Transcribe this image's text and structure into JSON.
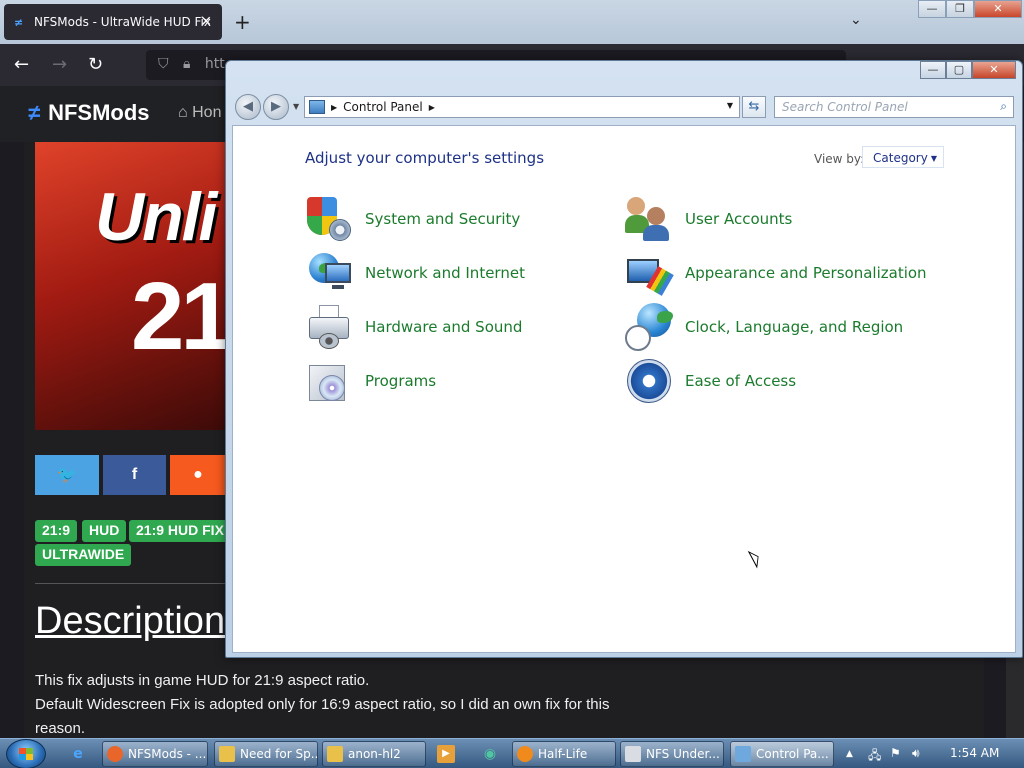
{
  "browser": {
    "tab_title": "NFSMods - UltraWide HUD Fix",
    "tab_close": "✕",
    "new_tab": "+",
    "tab_list": "⌄",
    "url_text": "htt",
    "win_min": "—",
    "win_max": "❐",
    "win_close": "✕",
    "nav_back": "←",
    "nav_forward": "→",
    "nav_reload": "↻"
  },
  "site": {
    "logo_text": "NFSMods",
    "home_text": "Hon",
    "hero_title": "Unli",
    "hero_ratio": "21:",
    "share": [
      {
        "label": "🐦",
        "color": "#4ca3e4"
      },
      {
        "label": "f",
        "color": "#3b5a9a"
      },
      {
        "label": "●",
        "color": "#f65a1e"
      }
    ],
    "tags": [
      "21:9",
      "HUD",
      "21:9 HUD FIX",
      "ULTRAWIDE"
    ],
    "description_heading": "Description",
    "description_lines": [
      "This fix adjusts in game HUD for 21:9 aspect ratio.",
      "Default Widescreen Fix is adopted only for 16:9 aspect ratio, so I did an own fix for this",
      "reason."
    ]
  },
  "control_panel": {
    "window_buttons": {
      "min": "—",
      "max": "▢",
      "close": "✕"
    },
    "address_path": "Control Panel",
    "search_placeholder": "Search Control Panel",
    "heading": "Adjust your computer's settings",
    "view_by_label": "View by:",
    "view_by_value": "Category",
    "categories_left": [
      {
        "label": "System and Security",
        "icon": "shield-icon"
      },
      {
        "label": "Network and Internet",
        "icon": "network-globe-icon"
      },
      {
        "label": "Hardware and Sound",
        "icon": "printer-icon"
      },
      {
        "label": "Programs",
        "icon": "programs-disc-icon"
      }
    ],
    "categories_right": [
      {
        "label": "User Accounts",
        "icon": "users-icon"
      },
      {
        "label": "Appearance and Personalization",
        "icon": "monitor-brush-icon"
      },
      {
        "label": "Clock, Language, and Region",
        "icon": "globe-clock-icon"
      },
      {
        "label": "Ease of Access",
        "icon": "ease-of-access-icon"
      }
    ]
  },
  "taskbar": {
    "items": [
      {
        "label": "NFSMods - ...",
        "icon_color": "#e8662a",
        "active": false
      },
      {
        "label": "Need for Sp...",
        "icon_color": "#e9c04a",
        "active": false
      },
      {
        "label": "anon-hl2",
        "icon_color": "#e9c04a",
        "active": false
      },
      {
        "label": "Half-Life",
        "icon_color": "#f08a1c",
        "active": false
      },
      {
        "label": "NFS Under...",
        "icon_color": "#d9dde3",
        "active": false
      },
      {
        "label": "Control Pa...",
        "icon_color": "#6fa8dc",
        "active": true
      }
    ],
    "clock": "1:54 AM"
  }
}
